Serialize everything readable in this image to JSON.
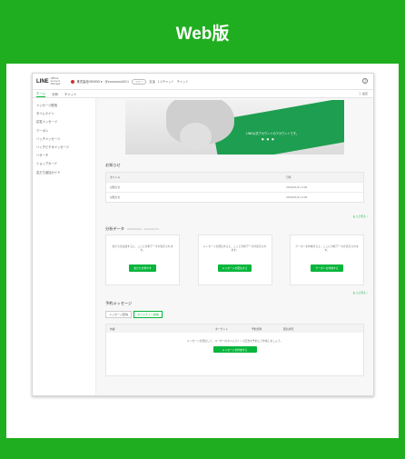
{
  "slide": {
    "title": "Web版"
  },
  "header": {
    "logo": "LINE",
    "logo_sub": "Official Account Manager",
    "account_name": "株式会社OOOOO ▾",
    "account_id": "@xxxxxxxx0011",
    "plan_badge": "フリー",
    "links": [
      "友達",
      "1:1チャット",
      "チャット"
    ]
  },
  "tabs": {
    "items": [
      "ホーム",
      "分析",
      "チャット"
    ],
    "active": "ホーム",
    "right_label": "ⓘ 設定"
  },
  "sidebar": {
    "items": [
      "メッセージ配信",
      "タイムライン",
      "応答メッセージ",
      "クーポン",
      "リッチメッセージ",
      "リッチビデオメッセージ",
      "リサーチ",
      "ショップカード",
      "友だち追加ガイド"
    ]
  },
  "banner": {
    "text": "LINE公式アカウントのアカウントです。",
    "dots": "● ● ●"
  },
  "notices": {
    "title": "お知らせ",
    "headers": [
      "タイトル",
      "日時"
    ],
    "rows": [
      {
        "title": "お知らせ",
        "date": "2019/01/21 9:00"
      },
      {
        "title": "お知らせ",
        "date": "2019/01/21 9:00"
      }
    ],
    "more": "もっと見る ›"
  },
  "stats": {
    "title": "分析データ",
    "subtitle": "2019/01/01 - 2019/01/31",
    "cards": [
      {
        "text": "友だちを追加すると、ここに分析データが表示されます。",
        "button": "友だちを増やす"
      },
      {
        "text": "メッセージを配信すると、ここに分析データが表示されます。",
        "button": "メッセージを配信する"
      },
      {
        "text": "クーポンを作成すると、ここに分析データが表示されます。",
        "button": "クーポンを作成する"
      }
    ],
    "more": "もっと見る ›"
  },
  "scheduled": {
    "title": "予約メッセージ",
    "tabs": [
      "メッセージ配信",
      "タイムライン投稿"
    ],
    "active_tab": "タイムライン投稿",
    "headers": [
      "内容",
      "ターゲット",
      "予約日時",
      "配信状況"
    ],
    "empty_text": "メッセージを配信して、ユーザーのタイムラインで広告を予約して作成しましょう。",
    "button": "メッセージを作成する"
  }
}
